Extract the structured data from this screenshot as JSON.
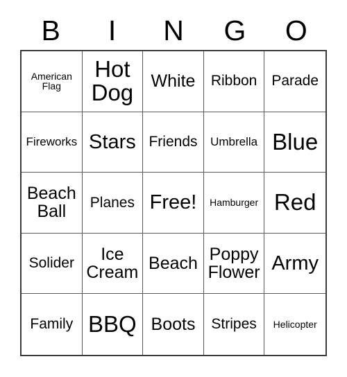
{
  "card": {
    "title": "BINGO Card",
    "header_letters": [
      "B",
      "I",
      "N",
      "G",
      "O"
    ],
    "grid": {
      "columns": 5,
      "rows": 5,
      "border_color": "#3a3a3a",
      "cell_border_color": "#5a5a5a",
      "background_color": "#ffffff",
      "text_color": "#000000"
    },
    "cells": [
      {
        "text": "American\nFlag",
        "size": "xs",
        "free": false
      },
      {
        "text": "Hot\nDog",
        "size": "xxl",
        "free": false
      },
      {
        "text": "White",
        "size": "l",
        "free": false
      },
      {
        "text": "Ribbon",
        "size": "m",
        "free": false
      },
      {
        "text": "Parade",
        "size": "m",
        "free": false
      },
      {
        "text": "Fireworks",
        "size": "s",
        "free": false
      },
      {
        "text": "Stars",
        "size": "xl",
        "free": false
      },
      {
        "text": "Friends",
        "size": "m",
        "free": false
      },
      {
        "text": "Umbrella",
        "size": "s",
        "free": false
      },
      {
        "text": "Blue",
        "size": "xxl",
        "free": false
      },
      {
        "text": "Beach\nBall",
        "size": "l",
        "free": false
      },
      {
        "text": "Planes",
        "size": "m",
        "free": false
      },
      {
        "text": "Free!",
        "size": "xl",
        "free": true
      },
      {
        "text": "Hamburger",
        "size": "xs",
        "free": false
      },
      {
        "text": "Red",
        "size": "xxl",
        "free": false
      },
      {
        "text": "Solider",
        "size": "m",
        "free": false
      },
      {
        "text": "Ice\nCream",
        "size": "l",
        "free": false
      },
      {
        "text": "Beach",
        "size": "l",
        "free": false
      },
      {
        "text": "Poppy\nFlower",
        "size": "l",
        "free": false
      },
      {
        "text": "Army",
        "size": "xl",
        "free": false
      },
      {
        "text": "Family",
        "size": "m",
        "free": false
      },
      {
        "text": "BBQ",
        "size": "xxl",
        "free": false
      },
      {
        "text": "Boots",
        "size": "l",
        "free": false
      },
      {
        "text": "Stripes",
        "size": "m",
        "free": false
      },
      {
        "text": "Helicopter",
        "size": "xs",
        "free": false
      }
    ]
  }
}
